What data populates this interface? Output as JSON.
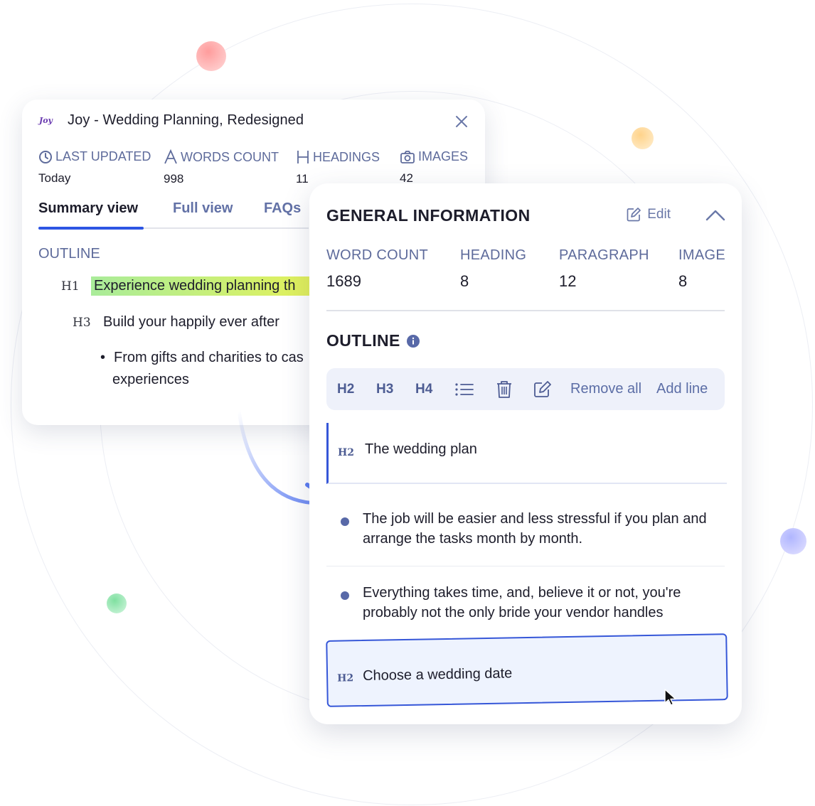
{
  "back_card": {
    "logo_text": "Joy",
    "title": "Joy - Wedding Planning, Redesigned",
    "stats": [
      {
        "label": "LAST UPDATED",
        "value": "Today",
        "icon": "clock-icon"
      },
      {
        "label": "WORDS COUNT",
        "value": "998",
        "icon": "letter-a-icon"
      },
      {
        "label": "HEADINGS",
        "value": "11",
        "icon": "letter-h-icon"
      },
      {
        "label": "IMAGES",
        "value": "42",
        "icon": "camera-icon"
      }
    ],
    "tabs": [
      "Summary view",
      "Full view",
      "FAQs"
    ],
    "active_tab": "Summary view",
    "outline_label": "OUTLINE",
    "outline": [
      {
        "tag": "H1",
        "text": "Experience wedding planning th"
      },
      {
        "tag": "H3",
        "text": "Build your happily ever after"
      },
      {
        "tag": "•",
        "text": "From gifts and charities to cas",
        "text2": "experiences"
      }
    ]
  },
  "front_card": {
    "title": "GENERAL INFORMATION",
    "edit_label": "Edit",
    "info": [
      {
        "label": "WORD COUNT",
        "value": "1689"
      },
      {
        "label": "HEADING",
        "value": "8"
      },
      {
        "label": "PARAGRAPH",
        "value": "12"
      },
      {
        "label": "IMAGE",
        "value": "8"
      }
    ],
    "outline_title": "OUTLINE",
    "toolbar": {
      "h2": "H2",
      "h3": "H3",
      "h4": "H4",
      "remove_all": "Remove all",
      "add_line": "Add line"
    },
    "items": [
      {
        "tag": "H2",
        "text": "The wedding plan"
      },
      {
        "text": "The job will be easier and less stressful if you plan and arrange the tasks month by month."
      },
      {
        "text": "Everything takes time, and, believe it or not, you're probably not the only bride your vendor handles"
      },
      {
        "tag": "H2",
        "text": "Choose a wedding date"
      }
    ]
  },
  "colors": {
    "accent": "#3657d8",
    "label": "#5e6b9b",
    "text": "#1d1d2b",
    "highlight_start": "#a9ec9a",
    "highlight_end": "#e3f15a"
  }
}
